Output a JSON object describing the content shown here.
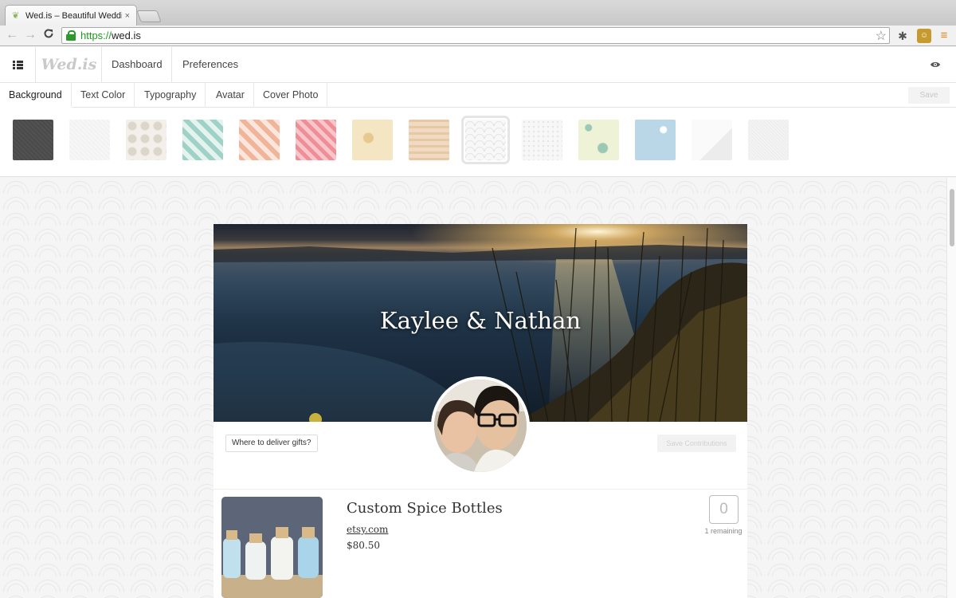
{
  "browser": {
    "tab_title": "Wed.is – Beautiful Wedding",
    "url_scheme": "https://",
    "url_host": "wed.is",
    "back_icon": "←",
    "forward_icon": "→",
    "reload_icon": "C",
    "star_icon": "☆",
    "close_icon": "×"
  },
  "app": {
    "logo": "Wed.is",
    "nav": {
      "dashboard": "Dashboard",
      "preferences": "Preferences"
    }
  },
  "design_tabs": [
    "Background",
    "Text Color",
    "Typography",
    "Avatar",
    "Cover Photo"
  ],
  "save_label": "Save",
  "swatches": [
    {
      "name": "dark-linen",
      "color": "#4a4a4a"
    },
    {
      "name": "white-linen",
      "color": "#f2f2f2"
    },
    {
      "name": "damask",
      "color": "#ece8e3"
    },
    {
      "name": "mint-plaid",
      "color": "#bfe0d8"
    },
    {
      "name": "peach-plaid",
      "color": "#f3c7b0"
    },
    {
      "name": "pink-stripe",
      "color": "#f19aa0"
    },
    {
      "name": "cream-floral",
      "color": "#f4e5c3"
    },
    {
      "name": "wood",
      "color": "#ecd4b5"
    },
    {
      "name": "scallop",
      "color": "#f4f4f4"
    },
    {
      "name": "light-dots",
      "color": "#f3f3f3"
    },
    {
      "name": "mint-flourish",
      "color": "#eef3d8"
    },
    {
      "name": "blue-snowflake",
      "color": "#b9d7e6"
    },
    {
      "name": "white-fold",
      "color": "#f6f6f6"
    },
    {
      "name": "light-texture",
      "color": "#eeeeee"
    }
  ],
  "selected_swatch": 8,
  "wedding": {
    "couple": "Kaylee & Nathan",
    "deliver_button": "Where to deliver gifts?",
    "save_contributions": "Save Contributions"
  },
  "gift": {
    "title": "Custom Spice Bottles",
    "link": "etsy.com",
    "price": "$80.50",
    "quantity": "0",
    "remaining": "1 remaining"
  }
}
